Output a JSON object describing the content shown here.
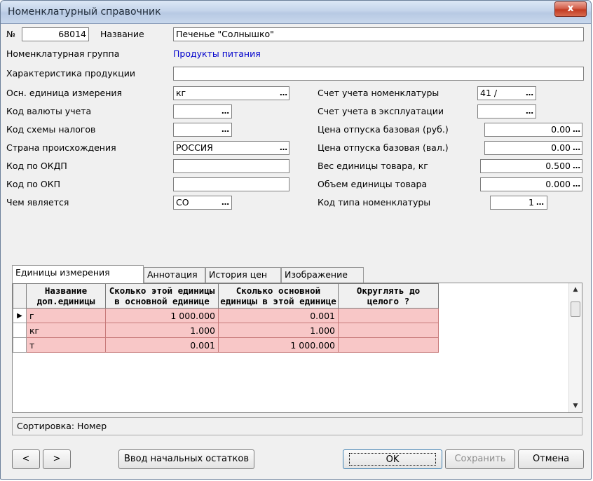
{
  "window": {
    "title": "Номенклатурный справочник",
    "close_glyph": "x"
  },
  "header": {
    "number_label": "№",
    "number_value": "68014",
    "name_label": "Название",
    "name_value": "Печенье \"Солнышко\"",
    "group_label": "Номенклатурная группа",
    "group_value": "Продукты питания",
    "characteristic_label": "Характеристика продукции",
    "characteristic_value": ""
  },
  "left_fields": [
    {
      "label": "Осн. единица измерения",
      "value": "кг"
    },
    {
      "label": "Код валюты учета",
      "value": ""
    },
    {
      "label": "Код схемы налогов",
      "value": ""
    },
    {
      "label": "Страна происхождения",
      "value": "РОССИЯ"
    },
    {
      "label": "Код по ОКДП",
      "value": ""
    },
    {
      "label": "Код по ОКП",
      "value": ""
    },
    {
      "label": "Чем является",
      "value": "СО"
    }
  ],
  "right_fields": [
    {
      "label": "Счет учета номенклатуры",
      "value": "41 /"
    },
    {
      "label": "Счет учета в эксплуатации",
      "value": ""
    },
    {
      "label": "Цена отпуска базовая (руб.)",
      "value": "0.00"
    },
    {
      "label": "Цена отпуска базовая (вал.)",
      "value": "0.00"
    },
    {
      "label": "Вес единицы товара, кг",
      "value": "0.500"
    },
    {
      "label": "Объем единицы товара",
      "value": "0.000"
    },
    {
      "label": "Код типа номенклатуры",
      "value": "1"
    }
  ],
  "ellipsis": "…",
  "tabs": [
    {
      "label": "Единицы измерения",
      "active": true
    },
    {
      "label": "Аннотация",
      "active": false
    },
    {
      "label": "История цен",
      "active": false
    },
    {
      "label": "Изображение",
      "active": false
    }
  ],
  "grid": {
    "columns": [
      "Название доп.единицы",
      "Сколько этой единицы в основной единице",
      "Сколько основной единицы в этой единице",
      "Округлять до целого ?"
    ],
    "rows": [
      {
        "name": "г",
        "in_base": "1 000.000",
        "base_in": "0.001",
        "round": "",
        "current": true
      },
      {
        "name": "кг",
        "in_base": "1.000",
        "base_in": "1.000",
        "round": "",
        "current": false
      },
      {
        "name": "т",
        "in_base": "0.001",
        "base_in": "1 000.000",
        "round": "",
        "current": false
      }
    ],
    "row_pointer": "▶",
    "row_color": "#f8c7c7"
  },
  "sort_label": "Сортировка: Номер",
  "buttons": {
    "prev": "<",
    "next": ">",
    "initial_balances": "Ввод начальных остатков",
    "ok": "OK",
    "save": "Сохранить",
    "cancel": "Отмена"
  }
}
